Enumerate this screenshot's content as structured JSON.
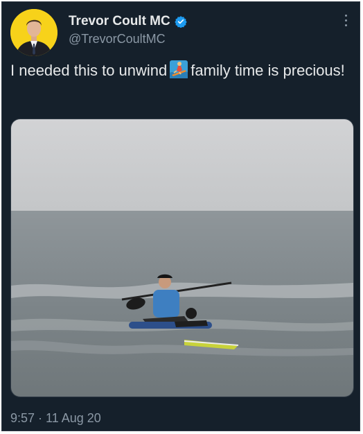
{
  "tweet": {
    "author_name": "Trevor Coult MC",
    "handle": "@TrevorCoultMC",
    "text_before_emoji": "I needed this to unwind",
    "text_after_emoji": "family time is precious!",
    "emoji": "person-surfing-emoji",
    "timestamp": "9:57 · 11 Aug 20",
    "verified": true
  },
  "icons": {
    "verified": "verified-badge-icon",
    "more": "more-options-icon"
  },
  "colors": {
    "background": "#15202b",
    "text_primary": "#e7e9ea",
    "text_secondary": "#8b98a5",
    "verified_blue": "#1d9bf0",
    "avatar_bg": "#f7d21a"
  }
}
